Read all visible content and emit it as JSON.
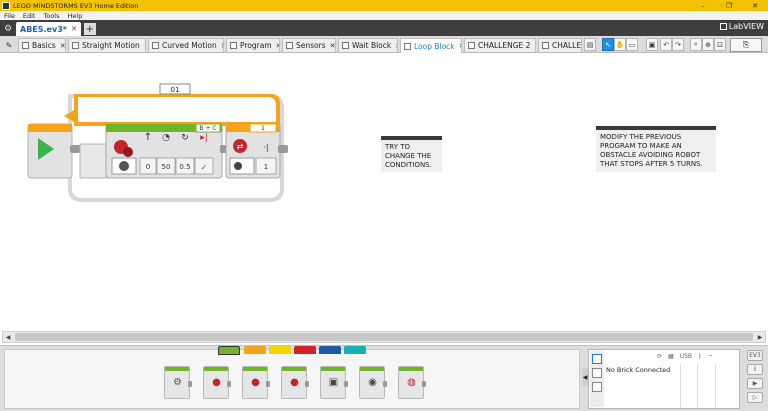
{
  "window": {
    "title": "LEGO MINDSTORMS EV3 Home Edition",
    "minimize": "–",
    "maximize": "❐",
    "close": "✕"
  },
  "menu": [
    "File",
    "Edit",
    "Tools",
    "Help"
  ],
  "project": {
    "tab_label": "ABES.ev3*",
    "close": "✕",
    "add": "+",
    "brand": "LabVIEW"
  },
  "program_tabs": [
    {
      "label": "Basics",
      "active": false
    },
    {
      "label": "Straight Motion",
      "active": false
    },
    {
      "label": "Curved Motion",
      "active": false
    },
    {
      "label": "Program",
      "active": false
    },
    {
      "label": "Sensors",
      "active": false
    },
    {
      "label": "Wait Block",
      "active": false
    },
    {
      "label": "Loop Block",
      "active": true
    },
    {
      "label": "CHALLENGE 2",
      "active": false
    },
    {
      "label": "CHALLE",
      "active": false
    }
  ],
  "tab_close": "✕",
  "program": {
    "loop_name": "01",
    "loop_count_label": "1",
    "move_port": "B + C",
    "move_values": [
      "0",
      "50",
      "0.5"
    ],
    "compare_value": "1"
  },
  "comments": {
    "left": "TRY TO CHANGE THE CONDITIONS.",
    "right": "MODIFY THE PREVIOUS PROGRAM TO MAKE AN OBSTACLE AVOIDING ROBOT THAT STOPS AFTER 5 TURNS."
  },
  "palette_colors": [
    "#6fb52c",
    "#f5a31a",
    "#f4d400",
    "#d2232a",
    "#1e5aa8",
    "#1bb0b4"
  ],
  "hardware": {
    "status": "No Brick Connected",
    "usb_label": "USB",
    "brick_label": "EV3"
  },
  "colors": {
    "title_bar": "#f2c200",
    "project_bar": "#3e3e3e",
    "loop_orange": "#f5a31a",
    "action_green": "#6fb52c",
    "accent_blue": "#1f7fd1"
  }
}
